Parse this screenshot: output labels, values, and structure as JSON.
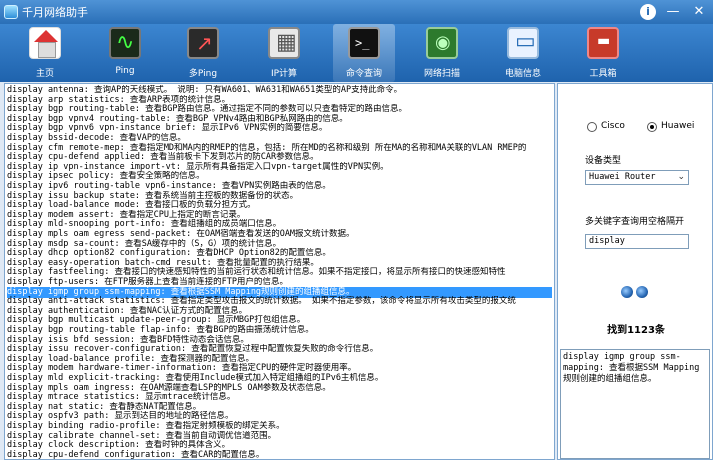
{
  "window": {
    "title": "千月网络助手"
  },
  "toolbar": {
    "items": [
      {
        "label": "主页",
        "icon": "home-icon"
      },
      {
        "label": "Ping",
        "icon": "ping-icon"
      },
      {
        "label": "多Ping",
        "icon": "multi-ping-icon"
      },
      {
        "label": "IP计算",
        "icon": "calculator-icon"
      },
      {
        "label": "命令查询",
        "icon": "terminal-icon"
      },
      {
        "label": "网络扫描",
        "icon": "scan-icon"
      },
      {
        "label": "电脑信息",
        "icon": "computer-icon"
      },
      {
        "label": "工具箱",
        "icon": "toolbox-icon"
      }
    ],
    "active_index": 4
  },
  "commands": [
    "display antenna: 查询AP的天线模式。 说明: 只有WA601、WA631和WA651类型的AP支持此命令。",
    "display arp statistics: 查看ARP表项的统计信息。",
    "display bgp routing-table: 查看BGP路由信息。通过指定不同的参数可以只查看特定的路由信息。",
    "display bgp vpnv4 routing-table: 查看BGP VPNv4路由和BGP私网路由的信息。",
    "display bgp vpnv6 vpn-instance brief: 显示IPv6 VPN实例的简要信息。",
    "display bssid-decode: 查看VAP的信息。",
    "display cfm remote-mep: 查看指定MD和MA内的RMEP的信息，包括: 所在MD的名称和级别 所在MA的名称和MA关联的VLAN RMEP的",
    "display cpu-defend applied: 查看当前板卡下发到芯片的防CAR参数信息。",
    "display ip vpn-instance import-vt: 显示所有具备指定入口vpn-target属性的VPN实例。",
    "display ipsec policy: 查看安全策略的信息。",
    "display ipv6 routing-table vpn6-instance: 查看VPN实例路由表的信息。",
    "display issu backup state: 查看系统当前主控板的数据备份的状态。",
    "display load-balance mode: 查看接口板的负载分担方式。",
    "display modem assert: 查看指定CPU上指定的断言记录。",
    "display mld-snooping port-info: 查看组播组的成员端口信息。",
    "display mpls oam egress send-packet: 在OAM宿端查看发送的OAM报文统计数据。",
    "display msdp sa-count: 查看SA缓存中的（S，G）项的统计信息。",
    "display dhcp option82 configuration: 查看DHCP Option82的配置信息。",
    "display easy-operation batch-cmd result: 查看批量配置的执行结果。",
    "display fastfeeling: 查看接口的快速感知特性的当前运行状态和统计信息。如果不指定接口，将显示所有接口的快速感知特性",
    "display ftp-users: 在FTP服务器上查看当前连接的FTP用户的信息。",
    "display igmp group ssm-mapping: 查看根据SSM Mapping规则创建的组播组信息。",
    "display anti-attack statistics: 查看指定类型攻击报文的统计数据。 如果不指定参数，该命令将显示所有攻击类型的报文统",
    "display authentication: 查看NAC认证方式的配置信息。",
    "display bgp multicast update-peer-group: 显示MBGP打包组信息。",
    "display bgp routing-table flap-info: 查看BGP的路由振荡统计信息。",
    "display isis bfd session: 查看BFD特性动态会话信息。",
    "display issu recover-configuration: 查看配置恢复过程中配置恢复失败的命令行信息。",
    "display load-balance profile: 查看探测器的配置信息。",
    "display modem hardware-timer-information: 查看指定CPU的硬件定时器使用率。",
    "display mld explicit-tracking: 查看使用Include模式加入特定组播组的IPv6主机信息。",
    "display mpls oam ingress: 在OAM源端查看LSP的MPLS OAM参数及状态信息。",
    "display mtrace statistics: 显示mtrace统计信息。",
    "display nat static: 查看静态NAT配置信息。",
    "display ospfv3 path: 显示到达目的地址的路径信息。",
    "display binding radio-profile: 查看指定射频模板的绑定关系。",
    "display calibrate channel-set: 查看当前自动调优信道范围。",
    "display clock description: 查看时钟的具体含义。",
    "display cpu-defend configuration: 查看CAR的配置信息。"
  ],
  "selected_index": 21,
  "side": {
    "vendors": [
      {
        "label": "Cisco",
        "selected": false
      },
      {
        "label": "Huawei",
        "selected": true
      }
    ],
    "device_type_label": "设备类型",
    "device_type_value": "Huawei Router",
    "keyword_label": "多关键字查询用空格隔开",
    "keyword_value": "display",
    "found_text": "找到1123条",
    "detail_text": "display igmp group ssm-mapping: 查看根据SSM Mapping规则创建的组播组信息。"
  }
}
